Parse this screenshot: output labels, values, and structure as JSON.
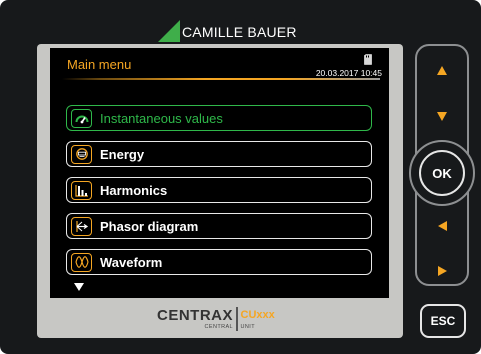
{
  "brand": {
    "name": "CAMILLE BAUER",
    "color": "#3fae4a"
  },
  "screen": {
    "title": "Main menu",
    "datetime": "20.03.2017  10:45",
    "menu_items": [
      {
        "label": "Instantaneous values",
        "icon": "gauge-icon",
        "active": true
      },
      {
        "label": "Energy",
        "icon": "energy-meter-icon",
        "active": false
      },
      {
        "label": "Harmonics",
        "icon": "harmonics-bars-icon",
        "active": false
      },
      {
        "label": "Phasor diagram",
        "icon": "phasor-icon",
        "active": false
      },
      {
        "label": "Waveform",
        "icon": "waveform-icon",
        "active": false
      }
    ],
    "accent_color": "#f5a623",
    "active_color": "#2fb84a"
  },
  "logo": {
    "main": "CENTRAX",
    "model": "CUxxx",
    "sub_left": "CENTRAL",
    "sub_right": "UNIT"
  },
  "buttons": {
    "up": "up-arrow-icon",
    "down": "down-arrow-icon",
    "ok": "OK",
    "left": "left-arrow-icon",
    "right": "right-arrow-icon",
    "esc": "ESC"
  }
}
